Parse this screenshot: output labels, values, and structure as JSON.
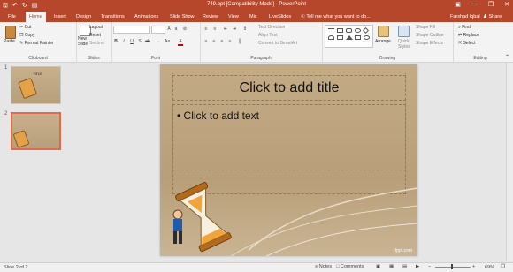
{
  "window": {
    "title": "749.ppt [Compatibility Mode] - PowerPoint"
  },
  "tabs": [
    "File",
    "Home",
    "Insert",
    "Design",
    "Transitions",
    "Animations",
    "Slide Show",
    "Review",
    "View",
    "Mix",
    "LiveSlides"
  ],
  "tellme": "Tell me what you want to do...",
  "user": "Farshad Iqbal",
  "share": "Share",
  "ribbon": {
    "clipboard": {
      "label": "Clipboard",
      "paste": "Paste",
      "cut": "Cut",
      "copy": "Copy",
      "painter": "Format Painter"
    },
    "slides": {
      "label": "Slides",
      "new_slide": "New",
      "new_slide2": "Slide",
      "layout": "Layout",
      "reset": "Reset",
      "section": "Section"
    },
    "font": {
      "label": "Font"
    },
    "paragraph": {
      "label": "Paragraph",
      "text_direction": "Text Direction",
      "align_text": "Align Text",
      "smartart": "Convert to SmartArt"
    },
    "drawing": {
      "label": "Drawing",
      "arrange": "Arrange",
      "quick_styles": "Quick",
      "quick_styles2": "Styles",
      "shape_fill": "Shape Fill",
      "shape_outline": "Shape Outline",
      "shape_effects": "Shape Effects"
    },
    "editing": {
      "label": "Editing",
      "find": "Find",
      "replace": "Replace",
      "select": "Select"
    }
  },
  "thumbs": [
    {
      "num": "1",
      "title": "TITLE"
    },
    {
      "num": "2"
    }
  ],
  "slide": {
    "title": "Click to add title",
    "body": "Click to add text",
    "watermark": "fppt.com"
  },
  "status": {
    "slide": "Slide 2 of 2",
    "notes": "Notes",
    "comments": "Comments",
    "zoom": "69%"
  },
  "colors": {
    "accent": "#b7472a",
    "selection": "#e06a4c"
  }
}
